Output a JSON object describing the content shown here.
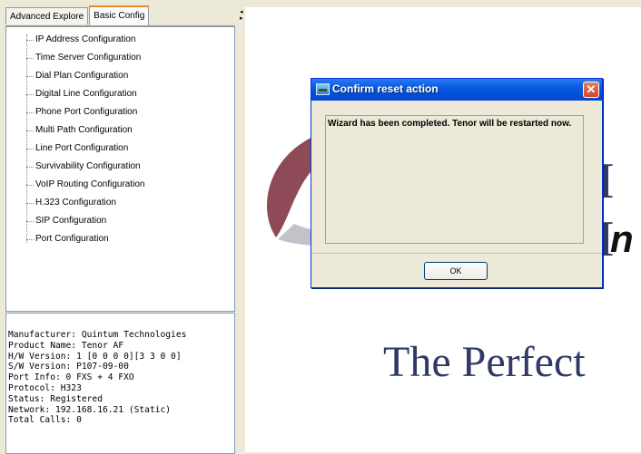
{
  "tabs": [
    "Advanced Explore",
    "Basic Config"
  ],
  "tree": [
    "IP Address Configuration",
    "Time Server Configuration",
    "Dial Plan Configuration",
    "Digital Line Configuration",
    "Phone Port Configuration",
    "Multi Path Configuration",
    "Line Port Configuration",
    "Survivability Configuration",
    "VoIP Routing Configuration",
    "H.323 Configuration",
    "SIP Configuration",
    "Port Configuration"
  ],
  "info": [
    "Manufacturer: Quintum Technologies",
    "Product Name: Tenor AF",
    "H/W Version: 1 [0 0 0 0][3 3 0 0]",
    "S/W Version: P107-09-00",
    "Port Info: 0 FXS + 4 FXO",
    "Protocol: H323",
    "Status: Registered",
    "Network: 192.168.16.21 (Static)",
    "Total Calls: 0"
  ],
  "dialog": {
    "title": "Confirm reset action",
    "close_glyph": "✕",
    "message": "Wizard has been completed. Tenor will be restarted now.",
    "ok_label": "OK"
  },
  "background": {
    "logo_letters": "I I",
    "logo_italic": "n",
    "tagline": "The Perfect"
  },
  "colors": {
    "titlebar": "#0a5ae0",
    "logo_blue": "#2f3a66",
    "logo_red": "#7a2a3a"
  }
}
